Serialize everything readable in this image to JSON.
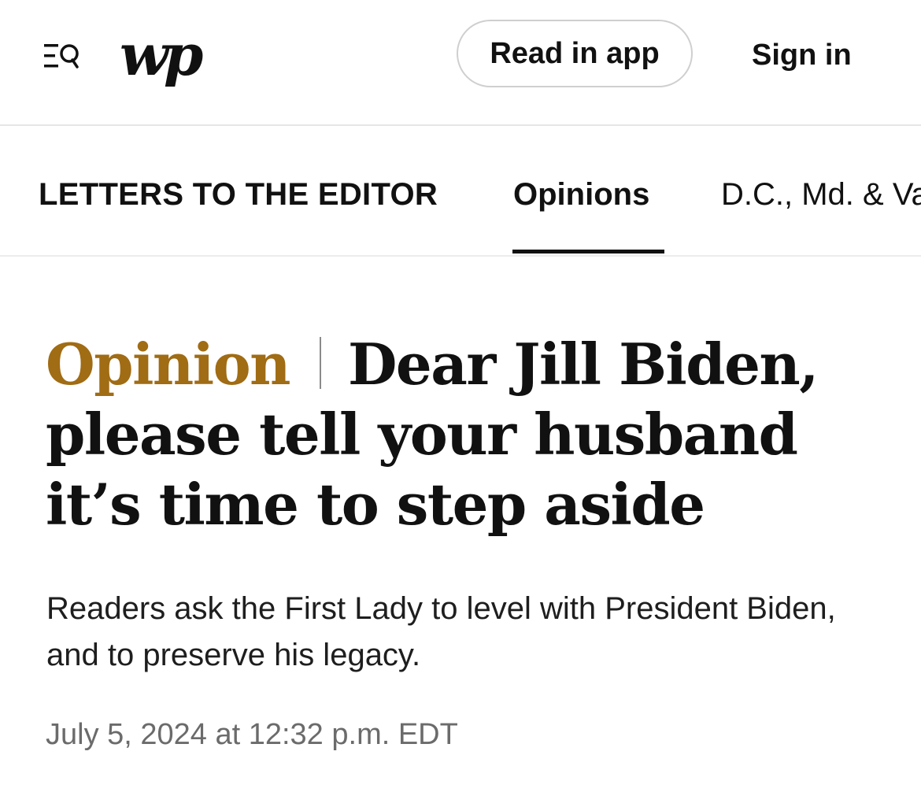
{
  "header": {
    "logo_text": "wp",
    "read_in_app_label": "Read in app",
    "sign_in_label": "Sign in",
    "menu_icon": "menu-search-icon"
  },
  "section_nav": {
    "items": [
      {
        "label": "LETTERS TO THE EDITOR",
        "active": false
      },
      {
        "label": "Opinions",
        "active": true
      },
      {
        "label": "D.C., Md. & Va.",
        "active": false
      }
    ]
  },
  "article": {
    "kicker": "Opinion",
    "headline": "Dear Jill Biden, please tell your husband it’s time to step aside",
    "dek": "Readers ask the First Lady to level with President Biden, and to preserve his legacy.",
    "timestamp": "July 5, 2024 at 12:32 p.m. EDT"
  },
  "colors": {
    "kicker": "#a06c14",
    "text": "#111111",
    "muted": "#6b6b6b",
    "border": "#cfcfcf"
  }
}
